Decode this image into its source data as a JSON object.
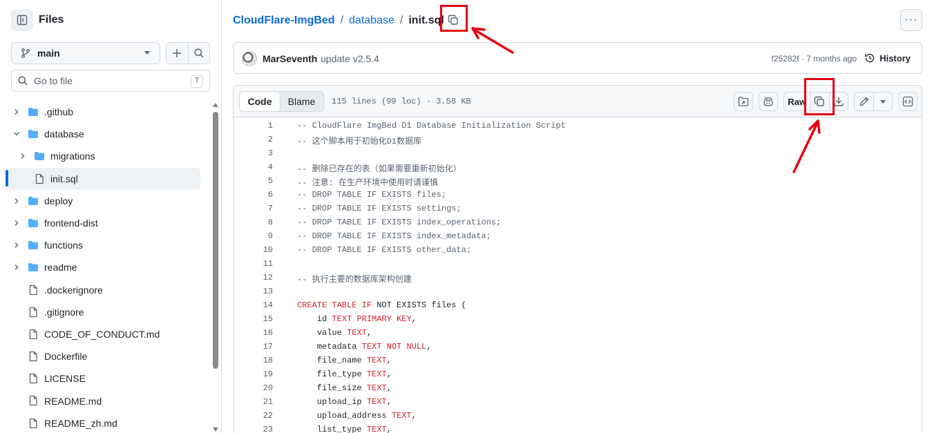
{
  "sidebar": {
    "title": "Files",
    "branch": "main",
    "goto_placeholder": "Go to file",
    "goto_shortcut": "T",
    "items": [
      {
        "label": ".github",
        "type": "folder",
        "depth": 0,
        "expanded": false
      },
      {
        "label": "database",
        "type": "folder",
        "depth": 0,
        "expanded": true
      },
      {
        "label": "migrations",
        "type": "folder",
        "depth": 1,
        "expanded": false
      },
      {
        "label": "init.sql",
        "type": "file",
        "depth": 1,
        "selected": true
      },
      {
        "label": "deploy",
        "type": "folder",
        "depth": 0,
        "expanded": false
      },
      {
        "label": "frontend-dist",
        "type": "folder",
        "depth": 0,
        "expanded": false
      },
      {
        "label": "functions",
        "type": "folder",
        "depth": 0,
        "expanded": false
      },
      {
        "label": "readme",
        "type": "folder",
        "depth": 0,
        "expanded": false
      },
      {
        "label": ".dockerignore",
        "type": "file",
        "depth": 0
      },
      {
        "label": ".gitignore",
        "type": "file",
        "depth": 0
      },
      {
        "label": "CODE_OF_CONDUCT.md",
        "type": "file",
        "depth": 0
      },
      {
        "label": "Dockerfile",
        "type": "file",
        "depth": 0
      },
      {
        "label": "LICENSE",
        "type": "file",
        "depth": 0
      },
      {
        "label": "README.md",
        "type": "file",
        "depth": 0
      },
      {
        "label": "README_zh.md",
        "type": "file",
        "depth": 0
      }
    ]
  },
  "breadcrumb": {
    "repo": "CloudFlare-ImgBed",
    "sep1": "/",
    "folder": "database",
    "sep2": "/",
    "file": "init.sql"
  },
  "commit": {
    "author": "MarSeventh",
    "message": "update v2.5.4",
    "sha_time": "f25282f · 7 months ago",
    "history_label": "History"
  },
  "file_header": {
    "tab_code": "Code",
    "tab_blame": "Blame",
    "meta": "115 lines (99 loc) · 3.58 KB",
    "raw_label": "Raw"
  },
  "code_lines": [
    [
      {
        "t": "-- CloudFlare ImgBed D1 Database Initialization Script",
        "c": "com"
      }
    ],
    [
      {
        "t": "-- 这个脚本用于初始化D1数据库",
        "c": "com"
      }
    ],
    [],
    [
      {
        "t": "-- 删除已存在的表（如果需要重新初始化）",
        "c": "com"
      }
    ],
    [
      {
        "t": "-- 注意: 在生产环境中使用时请谨慎",
        "c": "com"
      }
    ],
    [
      {
        "t": "-- DROP TABLE IF EXISTS files;",
        "c": "com"
      }
    ],
    [
      {
        "t": "-- DROP TABLE IF EXISTS settings;",
        "c": "com"
      }
    ],
    [
      {
        "t": "-- DROP TABLE IF EXISTS index_operations;",
        "c": "com"
      }
    ],
    [
      {
        "t": "-- DROP TABLE IF EXISTS index_metadata;",
        "c": "com"
      }
    ],
    [
      {
        "t": "-- DROP TABLE IF EXISTS other_data;",
        "c": "com"
      }
    ],
    [],
    [
      {
        "t": "-- 执行主要的数据库架构创建",
        "c": "com"
      }
    ],
    [],
    [
      {
        "t": "CREATE TABLE ",
        "c": "kw"
      },
      {
        "t": "IF",
        "c": "kw"
      },
      {
        "t": " NOT EXISTS files (",
        "c": "id"
      }
    ],
    [
      {
        "t": "    id ",
        "c": "id"
      },
      {
        "t": "TEXT PRIMARY KEY",
        "c": "kw"
      },
      {
        "t": ",",
        "c": "id"
      }
    ],
    [
      {
        "t": "    value ",
        "c": "id"
      },
      {
        "t": "TEXT",
        "c": "kw"
      },
      {
        "t": ",",
        "c": "id"
      }
    ],
    [
      {
        "t": "    metadata ",
        "c": "id"
      },
      {
        "t": "TEXT NOT NULL",
        "c": "kw"
      },
      {
        "t": ",",
        "c": "id"
      }
    ],
    [
      {
        "t": "    file_name ",
        "c": "id"
      },
      {
        "t": "TEXT",
        "c": "kw"
      },
      {
        "t": ",",
        "c": "id"
      }
    ],
    [
      {
        "t": "    file_type ",
        "c": "id"
      },
      {
        "t": "TEXT",
        "c": "kw"
      },
      {
        "t": ",",
        "c": "id"
      }
    ],
    [
      {
        "t": "    file_size ",
        "c": "id"
      },
      {
        "t": "TEXT",
        "c": "kw"
      },
      {
        "t": ",",
        "c": "id"
      }
    ],
    [
      {
        "t": "    upload_ip ",
        "c": "id"
      },
      {
        "t": "TEXT",
        "c": "kw"
      },
      {
        "t": ",",
        "c": "id"
      }
    ],
    [
      {
        "t": "    upload_address ",
        "c": "id"
      },
      {
        "t": "TEXT",
        "c": "kw"
      },
      {
        "t": ",",
        "c": "id"
      }
    ],
    [
      {
        "t": "    list_type ",
        "c": "id"
      },
      {
        "t": "TEXT",
        "c": "kw"
      },
      {
        "t": ",",
        "c": "id"
      }
    ]
  ],
  "colors": {
    "link": "#0969da",
    "keyword": "#cf222e",
    "comment": "#59636e",
    "annotation": "#e60012",
    "folder": "#54aeff"
  }
}
